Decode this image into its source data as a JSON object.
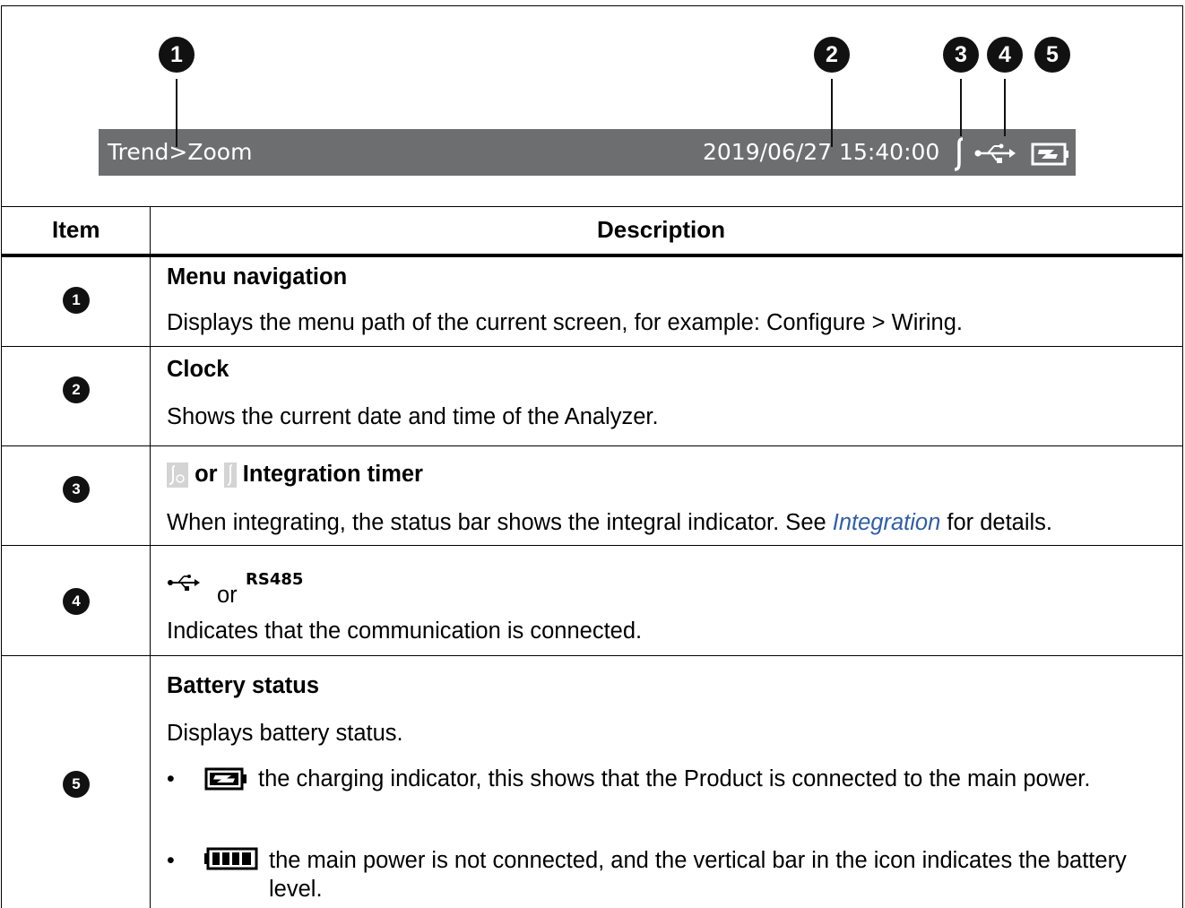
{
  "status_bar": {
    "menu_path": "Trend>Zoom",
    "clock": "2019/06/27 15:40:00",
    "integral_icon": "integral-icon",
    "usb_icon": "usb-icon",
    "battery_icon": "battery-charging-icon",
    "background_color": "#6d6e70"
  },
  "callouts": [
    "1",
    "2",
    "3",
    "4",
    "5"
  ],
  "table": {
    "headers": {
      "item": "Item",
      "description": "Description"
    },
    "rows": [
      {
        "item": "1",
        "title": "Menu navigation",
        "text": "Displays the menu path of the current screen, for example: Configure > Wiring."
      },
      {
        "item": "2",
        "title": "Clock",
        "text": "Shows the current date and time of the Analyzer."
      },
      {
        "item": "3",
        "or": "or",
        "title": "Integration timer",
        "text_before": "When integrating, the status bar shows the integral indicator. See ",
        "link": "Integration",
        "text_after": " for details."
      },
      {
        "item": "4",
        "or": "or",
        "rs485": "RS485",
        "text": "Indicates that the communication is connected."
      },
      {
        "item": "5",
        "title": "Battery status",
        "text": "Displays battery status.",
        "bullets": [
          {
            "marker": "•",
            "icon": "battery-charging-icon",
            "text": "the charging indicator, this shows that the Product is connected to the main power."
          },
          {
            "marker": "•",
            "icon": "battery-full-icon",
            "text": "the main power is not connected, and the vertical bar in the icon indicates the battery level."
          }
        ]
      }
    ]
  },
  "colors": {
    "link": "#2f5ea8",
    "callout": "#111111"
  }
}
